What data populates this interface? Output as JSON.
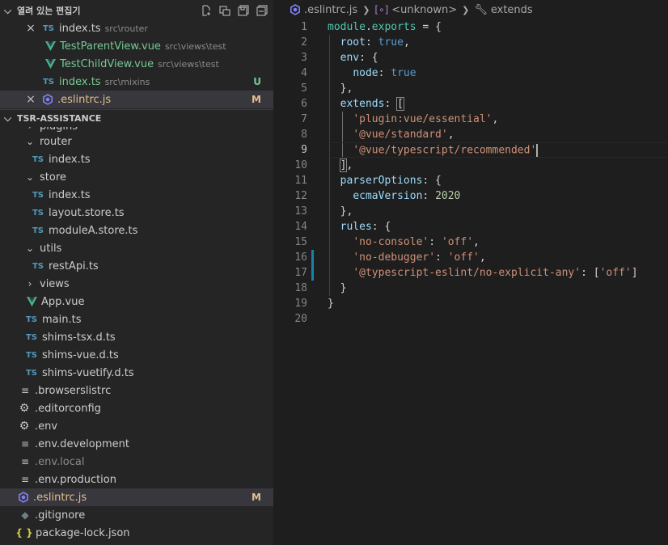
{
  "open_editors": {
    "title": "열려 있는 편집기",
    "items": [
      {
        "name": "index.ts",
        "path": "src\\router",
        "badge": ""
      },
      {
        "name": "TestParentView.vue",
        "path": "src\\views\\test",
        "badge": ""
      },
      {
        "name": "TestChildView.vue",
        "path": "src\\views\\test",
        "badge": ""
      },
      {
        "name": "index.ts",
        "path": "src\\mixins",
        "badge": "U"
      },
      {
        "name": ".eslintrc.js",
        "path": "",
        "badge": "M"
      }
    ]
  },
  "explorer": {
    "title": "TSR-ASSISTANCE",
    "items": [
      {
        "name": "plugins"
      },
      {
        "name": "router"
      },
      {
        "name": "index.ts"
      },
      {
        "name": "store"
      },
      {
        "name": "index.ts"
      },
      {
        "name": "layout.store.ts"
      },
      {
        "name": "moduleA.store.ts"
      },
      {
        "name": "utils"
      },
      {
        "name": "restApi.ts"
      },
      {
        "name": "views"
      },
      {
        "name": "App.vue"
      },
      {
        "name": "main.ts"
      },
      {
        "name": "shims-tsx.d.ts"
      },
      {
        "name": "shims-vue.d.ts"
      },
      {
        "name": "shims-vuetify.d.ts"
      },
      {
        "name": ".browserslistrc"
      },
      {
        "name": ".editorconfig"
      },
      {
        "name": ".env"
      },
      {
        "name": ".env.development"
      },
      {
        "name": ".env.local"
      },
      {
        "name": ".env.production"
      },
      {
        "name": ".eslintrc.js",
        "badge": "M"
      },
      {
        "name": ".gitignore"
      },
      {
        "name": "package-lock.json"
      }
    ]
  },
  "icons": {
    "ts_label": "TS",
    "close": "×",
    "json_label": "{ }"
  },
  "breadcrumb": {
    "file": ".eslintrc.js",
    "symbol1": "<unknown>",
    "symbol2": "extends"
  },
  "editor": {
    "cursor_line": 9,
    "lines": [
      {
        "n": "1",
        "tokens": [
          [
            "k",
            "module"
          ],
          [
            "d",
            "."
          ],
          [
            "k",
            "exports"
          ],
          [
            "d",
            " = {"
          ]
        ]
      },
      {
        "n": "2",
        "tokens": [
          [
            "d",
            "  "
          ],
          [
            "p",
            "root"
          ],
          [
            "d",
            ": "
          ],
          [
            "b",
            "true"
          ],
          [
            "d",
            ","
          ]
        ]
      },
      {
        "n": "3",
        "tokens": [
          [
            "d",
            "  "
          ],
          [
            "p",
            "env"
          ],
          [
            "d",
            ": {"
          ]
        ]
      },
      {
        "n": "4",
        "tokens": [
          [
            "d",
            "    "
          ],
          [
            "p",
            "node"
          ],
          [
            "d",
            ": "
          ],
          [
            "b",
            "true"
          ]
        ]
      },
      {
        "n": "5",
        "tokens": [
          [
            "d",
            "  },"
          ]
        ]
      },
      {
        "n": "6",
        "tokens": [
          [
            "d",
            "  "
          ],
          [
            "p",
            "extends"
          ],
          [
            "d",
            ": "
          ],
          [
            "d",
            "["
          ]
        ]
      },
      {
        "n": "7",
        "tokens": [
          [
            "d",
            "    "
          ],
          [
            "s",
            "'plugin:vue/essential'"
          ],
          [
            "d",
            ","
          ]
        ]
      },
      {
        "n": "8",
        "tokens": [
          [
            "d",
            "    "
          ],
          [
            "s",
            "'@vue/standard'"
          ],
          [
            "d",
            ","
          ]
        ]
      },
      {
        "n": "9",
        "tokens": [
          [
            "d",
            "    "
          ],
          [
            "s",
            "'@vue/typescript/recommended'"
          ]
        ]
      },
      {
        "n": "10",
        "tokens": [
          [
            "d",
            "  "
          ],
          [
            "d",
            "]"
          ],
          [
            "d",
            ","
          ]
        ]
      },
      {
        "n": "11",
        "tokens": [
          [
            "d",
            "  "
          ],
          [
            "p",
            "parserOptions"
          ],
          [
            "d",
            ": {"
          ]
        ]
      },
      {
        "n": "12",
        "tokens": [
          [
            "d",
            "    "
          ],
          [
            "p",
            "ecmaVersion"
          ],
          [
            "d",
            ": "
          ],
          [
            "n",
            "2020"
          ]
        ]
      },
      {
        "n": "13",
        "tokens": [
          [
            "d",
            "  },"
          ]
        ]
      },
      {
        "n": "14",
        "tokens": [
          [
            "d",
            "  "
          ],
          [
            "p",
            "rules"
          ],
          [
            "d",
            ": {"
          ]
        ]
      },
      {
        "n": "15",
        "tokens": [
          [
            "d",
            "    "
          ],
          [
            "s",
            "'no-console'"
          ],
          [
            "d",
            ": "
          ],
          [
            "s",
            "'off'"
          ],
          [
            "d",
            ","
          ]
        ]
      },
      {
        "n": "16",
        "tokens": [
          [
            "d",
            "    "
          ],
          [
            "s",
            "'no-debugger'"
          ],
          [
            "d",
            ": "
          ],
          [
            "s",
            "'off'"
          ],
          [
            "d",
            ","
          ]
        ]
      },
      {
        "n": "17",
        "tokens": [
          [
            "d",
            "    "
          ],
          [
            "s",
            "'@typescript-eslint/no-explicit-any'"
          ],
          [
            "d",
            ": ["
          ],
          [
            "s",
            "'off'"
          ],
          [
            "d",
            "]"
          ]
        ]
      },
      {
        "n": "18",
        "tokens": [
          [
            "d",
            "  }"
          ]
        ]
      },
      {
        "n": "19",
        "tokens": [
          [
            "d",
            "}"
          ]
        ]
      },
      {
        "n": "20",
        "tokens": []
      }
    ]
  },
  "colors": {
    "vue_green": "#41b883",
    "eslint_purple": "#8080f2",
    "ts_blue": "#519aba",
    "untracked": "#73c991",
    "modified": "#e2c08d",
    "gutter_modified": "#1b81a8"
  }
}
